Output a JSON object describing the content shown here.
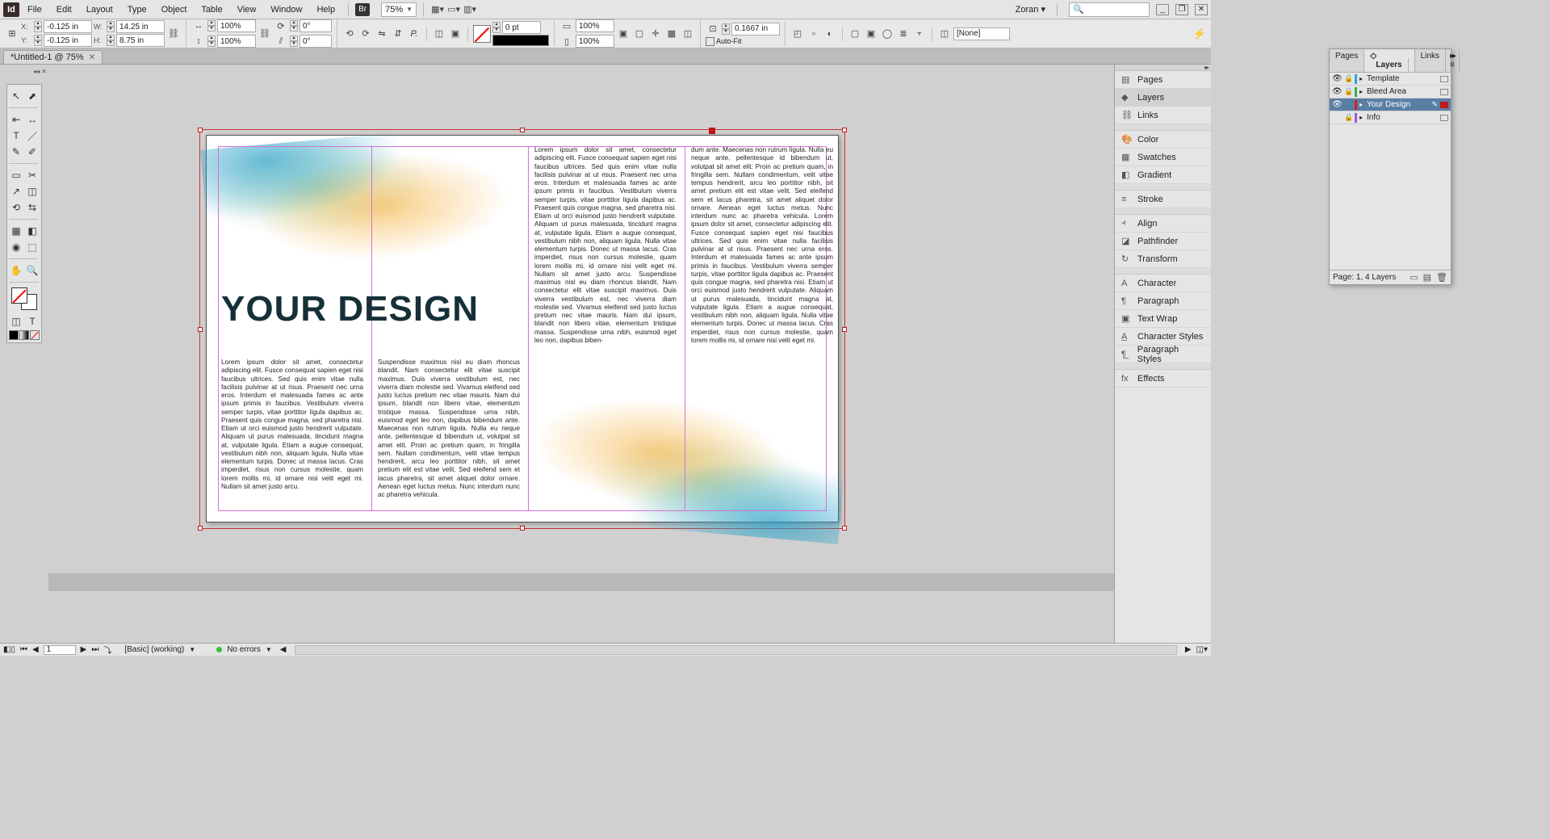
{
  "app": {
    "brand": "Id",
    "bridge_badge": "Br"
  },
  "menu": [
    "File",
    "Edit",
    "Layout",
    "Type",
    "Object",
    "Table",
    "View",
    "Window",
    "Help"
  ],
  "zoom": "75%",
  "user": "Zoran",
  "search_placeholder": "",
  "window_buttons": {
    "min": "_",
    "max": "❐",
    "close": "✕"
  },
  "control": {
    "ref": "⊞",
    "X": "-0.125 in",
    "Y": "-0.125 in",
    "W": "14.25 in",
    "H": "8.75 in",
    "scaleX": "100%",
    "scaleY": "100%",
    "rotate": "0°",
    "shear": "0°",
    "strokeWt": "0 pt",
    "cellPctW": "100%",
    "cellPctH": "100%",
    "cellInset": "0.1667 in",
    "autofit": "Auto-Fit",
    "styleName": "[None]"
  },
  "doc_tab": "*Untitled-1 @ 75%",
  "tools_left": [
    "↖",
    "⬈",
    "⇤",
    "↔",
    "T",
    "／",
    "✎",
    "✐",
    "▭",
    "✂",
    "↗",
    "◫",
    "⟲",
    "⇆",
    "▦",
    "◧",
    "◉",
    "⬚",
    "✋",
    "🔍"
  ],
  "headline": "YOUR DESIGN",
  "columns": {
    "c1": "Lorem ipsum dolor sit amet, consectetur adipiscing elit. Fusce consequat sapien eget nisi faucibus ultrices. Sed quis enim vitae nulla facilisis pulvinar at ut risus. Praesent nec urna eros. Interdum et malesuada fames ac ante ipsum primis in faucibus. Vestibulum viverra semper turpis, vitae porttitor ligula dapibus ac. Praesent quis congue magna, sed pharetra nisi. Etiam ut orci euismod justo hendrerit vulputate. Aliquam ut purus malesuada, tincidunt magna at, vulputate ligula. Etiam a augue consequat, vestibulum nibh non, aliquam ligula. Nulla vitae elementum turpis. Donec ut massa lacus. Cras imperdiet, risus non cursus molestie, quam lorem mollis mi, id ornare nisi velit eget mi. Nullam sit amet justo arcu.",
    "c2": "Suspendisse maximus nisl eu diam rhoncus blandit. Nam consectetur elit vitae suscipit maximus. Duis viverra vestibulum est, nec viverra diam molestie sed. Vivamus eleifend sed justo luctus pretium nec vitae mauris. Nam dui ipsum, blandit non libero vitae, elementum tristique massa. Suspendisse urna nibh, euismod eget leo non, dapibus bibendum ante. Maecenas non rutrum ligula. Nulla eu neque ante, pellentesque id bibendum ut, volutpat sit amet elit. Proin ac pretium quam, in fringilla sem. Nullam condimentum, velit vitae tempus hendrerit, arcu leo porttitor nibh, sit amet pretium elit est vitae velit. Sed eleifend sem et lacus pharetra, sit amet aliquet dolor ornare. Aenean eget luctus metus. Nunc interdum nunc ac pharetra vehicula.",
    "c3": "Lorem ipsum dolor sit amet, consectetur adipiscing elit. Fusce consequat sapien eget nisi faucibus ultrices. Sed quis enim vitae nulla facilisis pulvinar at ut risus. Praesent nec urna eros. Interdum et malesuada fames ac ante ipsum primis in faucibus. Vestibulum viverra semper turpis, vitae porttitor ligula dapibus ac. Praesent quis congue magna, sed pharetra nisi. Etiam ut orci euismod justo hendrerit vulputate. Aliquam ut purus malesuada, tincidunt magna at, vulputate ligula. Etiam a augue consequat, vestibulum nibh non, aliquam ligula. Nulla vitae elementum turpis. Donec ut massa lacus. Cras imperdiet, risus non cursus molestie, quam lorem mollis mi, id ornare nisi velit eget mi. Nullam sit amet justo arcu.\n\nSuspendisse maximus nisl eu diam rhoncus blandit. Nam consectetur elit vitae suscipit maximus. Duis viverra vestibulum est, nec viverra diam molestie sed. Vivamus eleifend sed justo luctus pretium nec vitae mauris. Nam dui ipsum, blandit non libero vitae, elementum tristique massa. Suspendisse urna nibh, euismod eget leo non, dapibus biben-",
    "c4": "dum ante. Maecenas non rutrum ligula. Nulla eu neque ante, pellentesque id bibendum ut, volutpat sit amet elit. Proin ac pretium quam, in fringilla sem. Nullam condimentum, velit vitae tempus hendrerit, arcu leo porttitor nibh, sit amet pretium elit est vitae velit. Sed eleifend sem et lacus pharetra, sit amet aliquet dolor ornare. Aenean eget luctus metus. Nunc interdum nunc ac pharetra vehicula.\n\nLorem ipsum dolor sit amet, consectetur adipiscing elit. Fusce consequat sapien eget nisi faucibus ultrices. Sed quis enim vitae nulla facilisis pulvinar at ut risus. Praesent nec urna eros. Interdum et malesuada fames ac ante ipsum primis in faucibus. Vestibulum viverra semper turpis, vitae porttitor ligula dapibus ac. Praesent quis congue magna, sed pharetra nisi. Etiam ut orci euismod justo hendrerit vulputate. Aliquam ut purus malesuada, tincidunt magna at, vulputate ligula. Etiam a augue consequat, vestibulum nibh non, aliquam ligula. Nulla vitae elementum turpis. Donec ut massa lacus. Cras imperdiet, risus non cursus molestie, quam lorem mollis mi, id ornare nisi velit eget mi."
  },
  "layers_panel": {
    "tabs": [
      "Pages",
      "Layers",
      "Links"
    ],
    "active_tab": 1,
    "rows": [
      {
        "name": "Template",
        "color": "#2aa6e0",
        "locked": true,
        "visible": true,
        "sel": false
      },
      {
        "name": "Bleed Area",
        "color": "#2fb24c",
        "locked": true,
        "visible": true,
        "sel": false
      },
      {
        "name": "Your Design",
        "color": "#d82020",
        "locked": false,
        "visible": true,
        "sel": true
      },
      {
        "name": "Info",
        "color": "#9b59e0",
        "locked": true,
        "visible": false,
        "sel": false
      }
    ],
    "footer": "Page: 1, 4 Layers"
  },
  "dock_items": [
    {
      "icon": "▤",
      "label": "Pages"
    },
    {
      "icon": "◆",
      "label": "Layers",
      "active": true
    },
    {
      "icon": "⛓",
      "label": "Links"
    },
    {
      "sep": true
    },
    {
      "icon": "🎨",
      "label": "Color"
    },
    {
      "icon": "▦",
      "label": "Swatches"
    },
    {
      "icon": "◧",
      "label": "Gradient"
    },
    {
      "sep": true
    },
    {
      "icon": "≡",
      "label": "Stroke"
    },
    {
      "sep": true
    },
    {
      "icon": "⫞",
      "label": "Align"
    },
    {
      "icon": "◪",
      "label": "Pathfinder"
    },
    {
      "icon": "↻",
      "label": "Transform"
    },
    {
      "sep": true
    },
    {
      "icon": "A",
      "label": "Character"
    },
    {
      "icon": "¶",
      "label": "Paragraph"
    },
    {
      "icon": "▣",
      "label": "Text Wrap"
    },
    {
      "icon": "A̲",
      "label": "Character Styles"
    },
    {
      "icon": "¶̲",
      "label": "Paragraph Styles"
    },
    {
      "sep": true
    },
    {
      "icon": "fx",
      "label": "Effects"
    }
  ],
  "status": {
    "pager": "1",
    "preset": "[Basic] (working)",
    "preflight": "No errors"
  }
}
